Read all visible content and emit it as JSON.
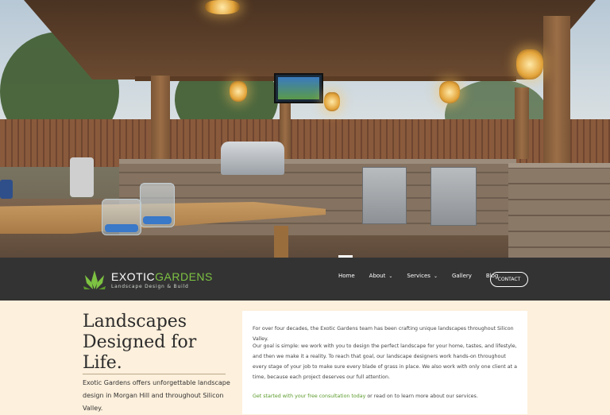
{
  "brand": {
    "name_part1": "EXOTIC",
    "name_part2": "GARDENS",
    "tagline": "Landscape Design & Build",
    "accent_color": "#7dc242"
  },
  "nav": {
    "items": [
      {
        "label": "Home",
        "has_dropdown": false
      },
      {
        "label": "About",
        "has_dropdown": true
      },
      {
        "label": "Services",
        "has_dropdown": true
      },
      {
        "label": "Gallery",
        "has_dropdown": false
      },
      {
        "label": "Blog",
        "has_dropdown": false
      }
    ],
    "dropdown_caret": "⌄",
    "contact_label": "CONTACT"
  },
  "hero": {
    "image_description": "outdoor kitchen under wooden pergola with lanterns"
  },
  "content": {
    "headline": "Landscapes Designed for Life.",
    "intro": "Exotic Gardens offers unforgettable landscape design in Morgan Hill and throughout Silicon Valley.",
    "paragraph1": "For over four decades, the Exotic Gardens team has been crafting unique landscapes throughout Silicon Valley.",
    "paragraph2": "Our goal is simple: we work with you to design the perfect landscape for your home, tastes, and lifestyle, and then we make it a reality. To reach that goal, our landscape designers work hands-on throughout every stage of your job to make sure every blade of grass in place. We also work with only one client at a time, because each project deserves our full attention.",
    "cta_link": "Get started with your free consultation today",
    "cta_rest": " or read on to learn more about our services."
  }
}
